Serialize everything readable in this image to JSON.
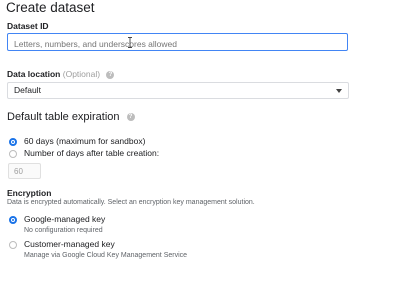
{
  "page_title": "Create dataset",
  "dataset_id": {
    "label": "Dataset ID",
    "placeholder": "Letters, numbers, and underscores allowed",
    "value": ""
  },
  "data_location": {
    "label": "Data location",
    "optional": "(Optional)",
    "selected": "Default",
    "help_icon": "help-icon"
  },
  "table_expiration": {
    "title": "Default table expiration",
    "options": [
      {
        "label": "60 days (maximum for sandbox)",
        "selected": true
      },
      {
        "label": "Number of days after table creation:",
        "selected": false
      }
    ],
    "days_value": "60"
  },
  "encryption": {
    "title": "Encryption",
    "description": "Data is encrypted automatically. Select an encryption key management solution.",
    "options": [
      {
        "label": "Google-managed key",
        "sublabel": "No configuration required",
        "selected": true
      },
      {
        "label": "Customer-managed key",
        "sublabel": "Manage via Google Cloud Key Management Service",
        "selected": false
      }
    ]
  },
  "colors": {
    "accent": "#1a73e8",
    "input_focus": "#4285f4"
  }
}
